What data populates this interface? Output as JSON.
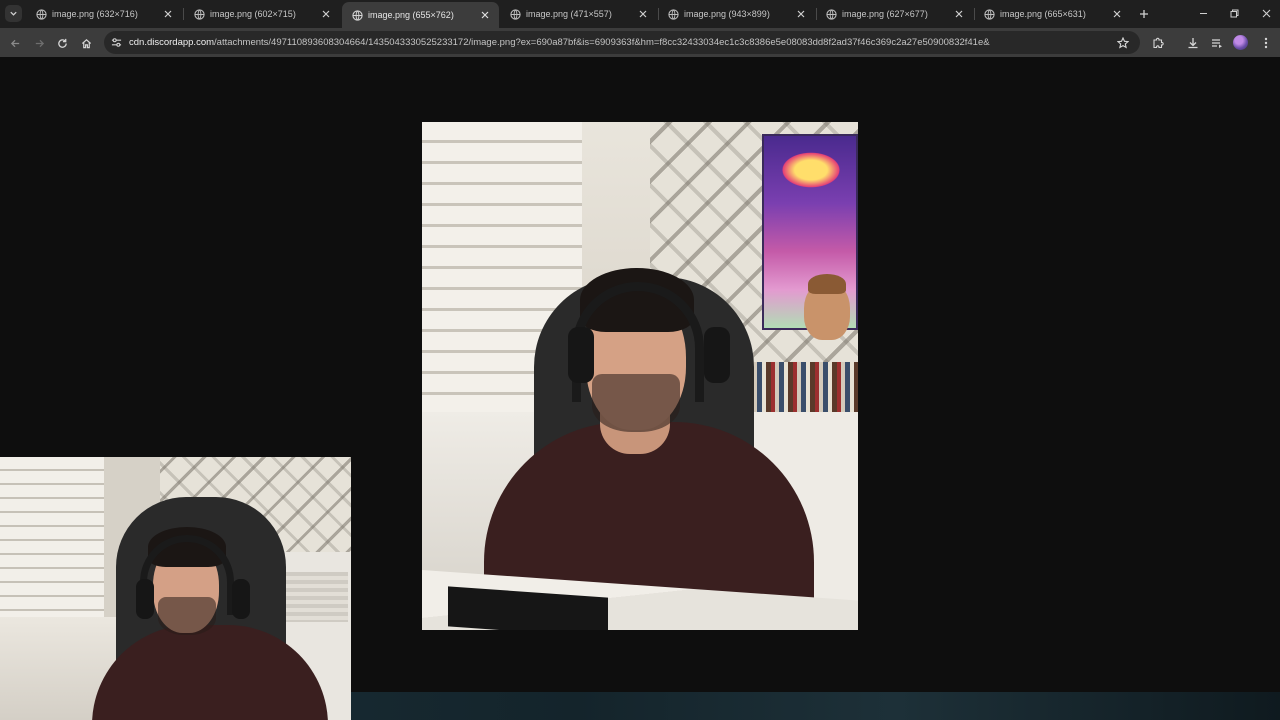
{
  "browser": {
    "tabs": [
      {
        "title": "image.png (632×716)",
        "active": false
      },
      {
        "title": "image.png (602×715)",
        "active": false
      },
      {
        "title": "image.png (655×762)",
        "active": true
      },
      {
        "title": "image.png (471×557)",
        "active": false
      },
      {
        "title": "image.png (943×899)",
        "active": false
      },
      {
        "title": "image.png (627×677)",
        "active": false
      },
      {
        "title": "image.png (665×631)",
        "active": false
      }
    ],
    "address": {
      "host": "cdn.discordapp.com",
      "path": "/attachments/497110893608304664/1435043330525233172/image.png?ex=690a87bf&is=6909363f&hm=f8cc32433034ec1c3c8386e5e08083dd8f2ad37f46c369c2a27e50900832f41e&"
    },
    "icons": {
      "tab_search": "chevron-down-icon",
      "tab_favicon": "globe-icon",
      "tab_close": "close-icon",
      "new_tab": "plus-icon",
      "back": "arrow-left-icon",
      "forward": "arrow-right-icon",
      "reload": "reload-icon",
      "home": "home-icon",
      "site_info": "tune-icon",
      "bookmark": "star-icon",
      "extensions": "puzzle-icon",
      "downloads": "download-icon",
      "media": "media-queue-icon",
      "profile": "avatar",
      "menu": "kebab-menu-icon",
      "minimize": "minimize-icon",
      "restore": "restore-icon",
      "close_window": "close-icon"
    }
  },
  "colors": {
    "tabstrip_bg": "#1f1f1f",
    "toolbar_bg": "#3c3c3c",
    "omnibox_bg": "#282828",
    "viewer_bg": "#0e0e0e",
    "shirt": "#3a1f1f"
  }
}
